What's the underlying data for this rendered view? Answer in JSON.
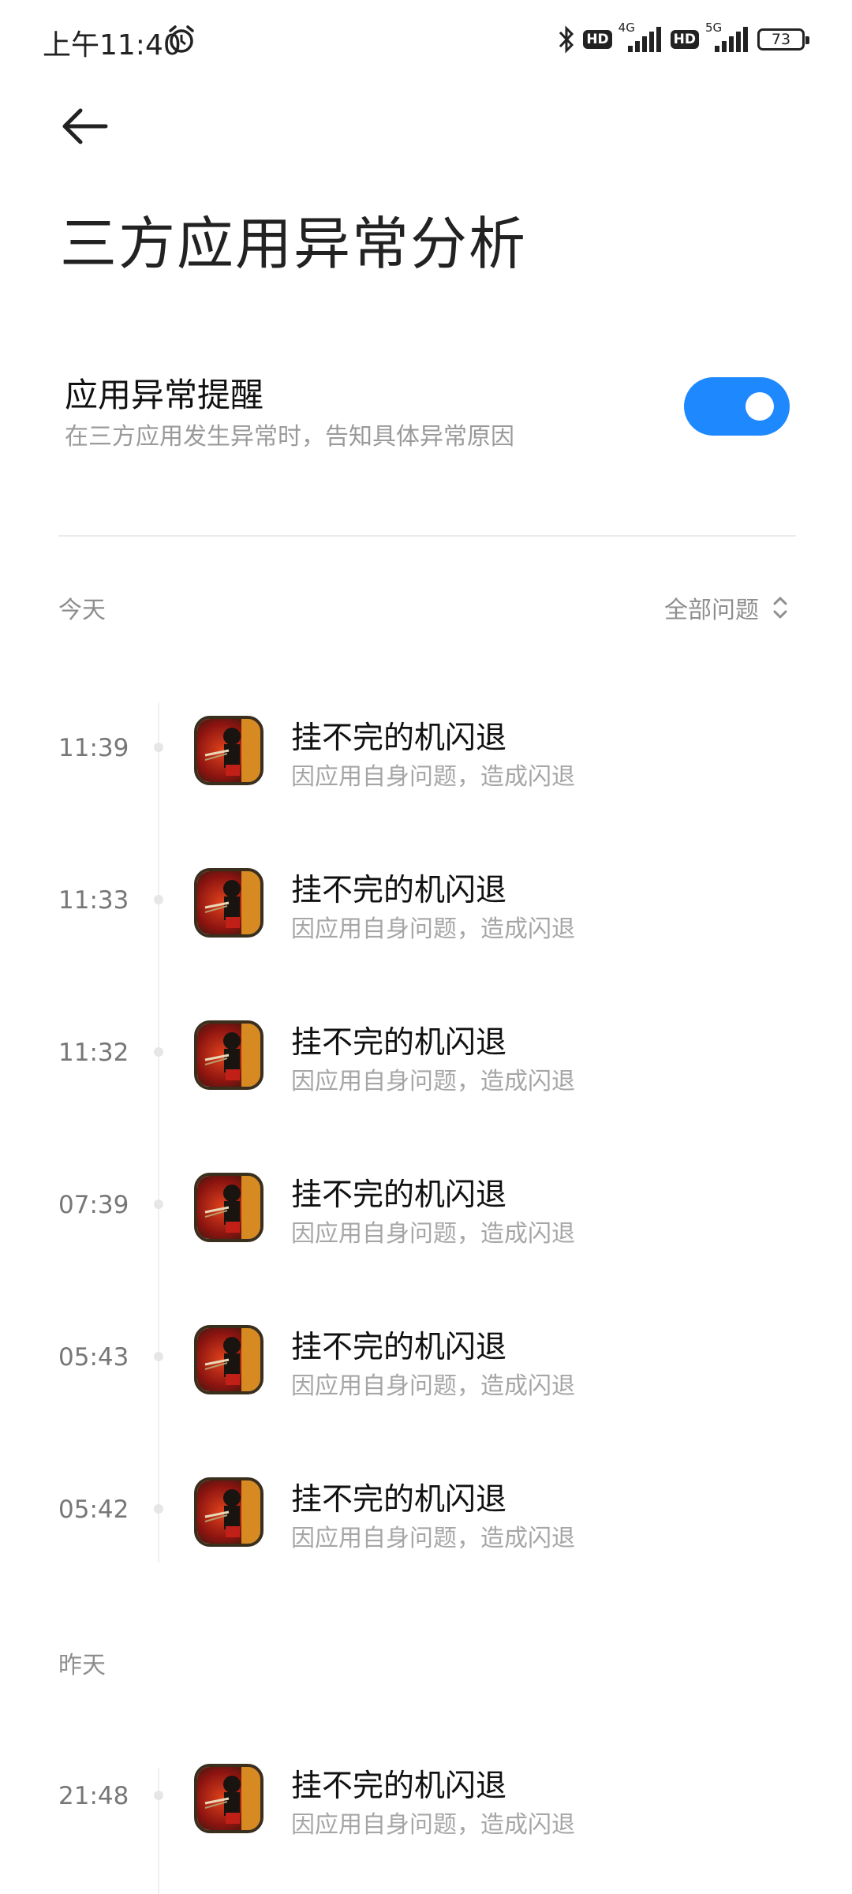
{
  "status_bar": {
    "time": "上午11:40",
    "network1": "4G",
    "network2": "5G",
    "hd": "HD",
    "battery": "73"
  },
  "header": {
    "back_icon": "arrow-left-icon",
    "title": "三方应用异常分析"
  },
  "setting": {
    "title": "应用异常提醒",
    "subtitle": "在三方应用发生异常时，告知具体异常原因",
    "toggle_on": true,
    "accent_color": "#1e88ff"
  },
  "filter": {
    "label": "全部问题"
  },
  "sections": [
    {
      "label": "今天",
      "items": [
        {
          "time": "11:39",
          "name": "挂不完的机闪退",
          "desc": "因应用自身问题，造成闪退"
        },
        {
          "time": "11:33",
          "name": "挂不完的机闪退",
          "desc": "因应用自身问题，造成闪退"
        },
        {
          "time": "11:32",
          "name": "挂不完的机闪退",
          "desc": "因应用自身问题，造成闪退"
        },
        {
          "time": "07:39",
          "name": "挂不完的机闪退",
          "desc": "因应用自身问题，造成闪退"
        },
        {
          "time": "05:43",
          "name": "挂不完的机闪退",
          "desc": "因应用自身问题，造成闪退"
        },
        {
          "time": "05:42",
          "name": "挂不完的机闪退",
          "desc": "因应用自身问题，造成闪退"
        }
      ]
    },
    {
      "label": "昨天",
      "items": [
        {
          "time": "21:48",
          "name": "挂不完的机闪退",
          "desc": "因应用自身问题，造成闪退"
        }
      ]
    }
  ]
}
